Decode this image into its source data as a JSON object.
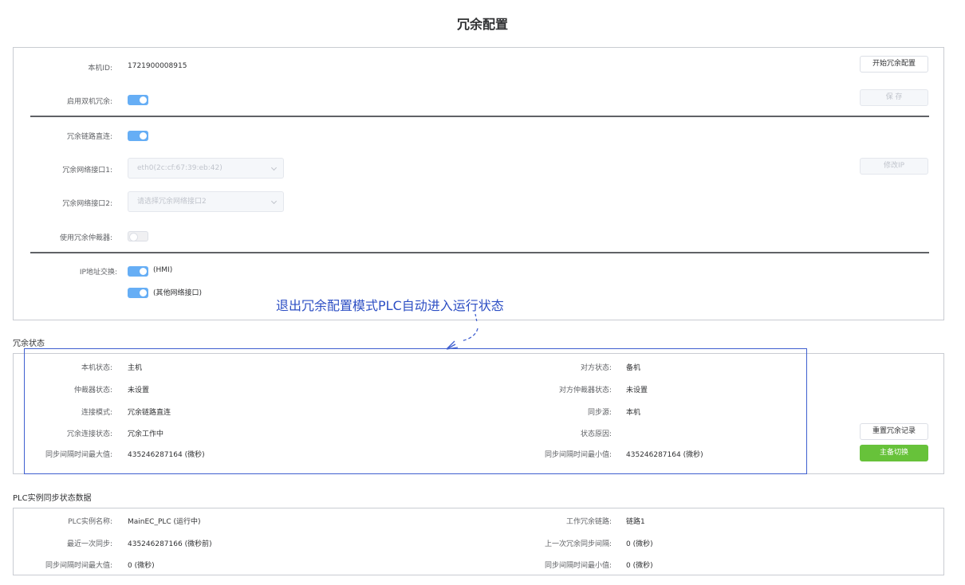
{
  "title": "冗余配置",
  "config": {
    "device_id_label": "本机ID:",
    "device_id_value": "1721900008915",
    "enable_dual_label": "启用双机冗余:",
    "link_direct_label": "冗余链路直连:",
    "iface1_label": "冗余网络接口1:",
    "iface1_value": "eth0(2c:cf:67:39:eb:42)",
    "iface2_label": "冗余网络接口2:",
    "iface2_placeholder": "请选择冗余网络接口2",
    "arbiter_label": "使用冗余仲裁器:",
    "ip_swap_label": "IP地址交换:",
    "ip_swap_hmi": "(HMI)",
    "ip_swap_other": "(其他网络接口)",
    "start_button": "开始冗余配置",
    "save_button": "保 存",
    "modify_ip_button": "修改IP"
  },
  "annotation": {
    "text": "退出冗余配置模式PLC自动进入运行状态",
    "color": "#2d4fc4"
  },
  "status": {
    "section_title": "冗余状态",
    "local_state_label": "本机状态:",
    "local_state_value": "主机",
    "peer_state_label": "对方状态:",
    "peer_state_value": "备机",
    "arbiter_state_label": "仲裁器状态:",
    "arbiter_state_value": "未设置",
    "peer_arbiter_label": "对方仲裁器状态:",
    "peer_arbiter_value": "未设置",
    "conn_mode_label": "连接模式:",
    "conn_mode_value": "冗余链路直连",
    "sync_source_label": "同步源:",
    "sync_source_value": "本机",
    "conn_state_label": "冗余连接状态:",
    "conn_state_value": "冗余工作中",
    "reason_label": "状态原因:",
    "reason_value": "",
    "max_interval_label": "同步间隔时间最大值:",
    "max_interval_value": "435246287164 (微秒)",
    "min_interval_label": "同步间隔时间最小值:",
    "min_interval_value": "435246287164 (微秒)",
    "reset_button": "重置冗余记录",
    "switch_button": "主备切换"
  },
  "sync": {
    "section_title": "PLC实例同步状态数据",
    "instance_label": "PLC实例名称:",
    "instance_value": "MainEC_PLC (运行中)",
    "link_label": "工作冗余链路:",
    "link_value": "链路1",
    "last_sync_label": "最近一次同步:",
    "last_sync_value": "435246287166 (微秒前)",
    "last_interval_label": "上一次冗余同步间隔:",
    "last_interval_value": "0 (微秒)",
    "max_label": "同步间隔时间最大值:",
    "max_value": "0 (微秒)",
    "min_label": "同步间隔时间最小值:",
    "min_value": "0 (微秒)"
  },
  "colors": {
    "switch_on": "#66aef5",
    "primary_button": "#67c23a",
    "annotation": "#2d4fc4"
  }
}
